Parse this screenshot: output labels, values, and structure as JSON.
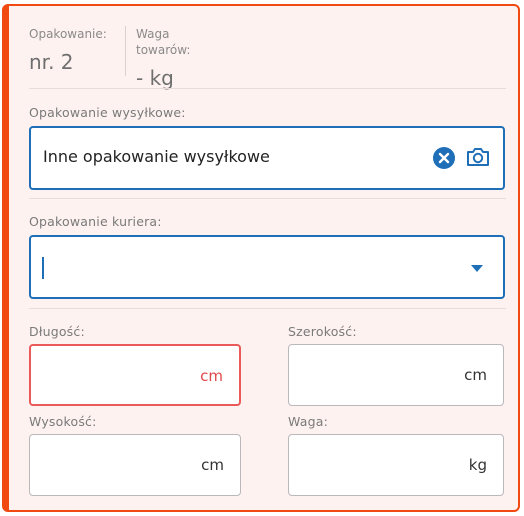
{
  "summary": {
    "packaging_label": "Opakowanie:",
    "packaging_value": "nr. 2",
    "weight_label": "Waga towarów:",
    "weight_value": "- kg"
  },
  "shipping_packaging": {
    "label": "Opakowanie wysyłkowe:",
    "value": "Inne opakowanie wysyłkowe",
    "clear_icon": "close-circle-icon",
    "camera_icon": "camera-icon"
  },
  "courier_packaging": {
    "label": "Opakowanie kuriera:",
    "value": ""
  },
  "dimensions": {
    "length": {
      "label": "Długość:",
      "value": "",
      "unit": "cm",
      "state": "error"
    },
    "width": {
      "label": "Szerokość:",
      "value": "",
      "unit": "cm"
    },
    "height": {
      "label": "Wysokość:",
      "value": "",
      "unit": "cm"
    },
    "weight": {
      "label": "Waga:",
      "value": "",
      "unit": "kg"
    }
  },
  "colors": {
    "accent": "#1f6fb8",
    "border_brand": "#f04a10",
    "error": "#ea5a5a",
    "card_bg": "#fdf2f0"
  }
}
